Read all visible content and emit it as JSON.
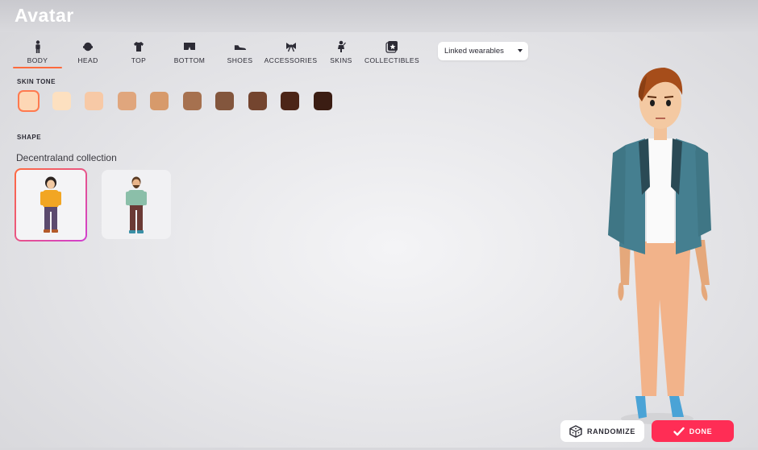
{
  "header": {
    "title": "Avatar"
  },
  "tabs": [
    {
      "label": "BODY",
      "icon": "body-icon",
      "active": true
    },
    {
      "label": "HEAD",
      "icon": "head-icon",
      "active": false
    },
    {
      "label": "TOP",
      "icon": "shirt-icon",
      "active": false
    },
    {
      "label": "BOTTOM",
      "icon": "pants-icon",
      "active": false
    },
    {
      "label": "SHOES",
      "icon": "shoe-icon",
      "active": false
    },
    {
      "label": "ACCESSORIES",
      "icon": "bow-icon",
      "active": false
    },
    {
      "label": "SKINS",
      "icon": "skin-icon",
      "active": false
    },
    {
      "label": "COLLECTIBLES",
      "icon": "collectibles-icon",
      "active": false
    }
  ],
  "filter": {
    "selected": "Linked wearables"
  },
  "skin_tone": {
    "label": "SKIN TONE",
    "selected_index": 0,
    "colors": [
      "#fdd7b5",
      "#fde0c0",
      "#f7c9a6",
      "#e0a67d",
      "#d79a6b",
      "#a6714f",
      "#83563d",
      "#74452f",
      "#4c2517",
      "#3b1d13"
    ]
  },
  "shape": {
    "label": "SHAPE",
    "collection_title": "Decentraland collection",
    "options": [
      {
        "name": "female-body",
        "selected": true
      },
      {
        "name": "male-body",
        "selected": false
      }
    ]
  },
  "actions": {
    "randomize_label": "RANDOMIZE",
    "done_label": "DONE"
  },
  "colors": {
    "accent": "#ff6a3d",
    "done": "#ff2d55"
  }
}
